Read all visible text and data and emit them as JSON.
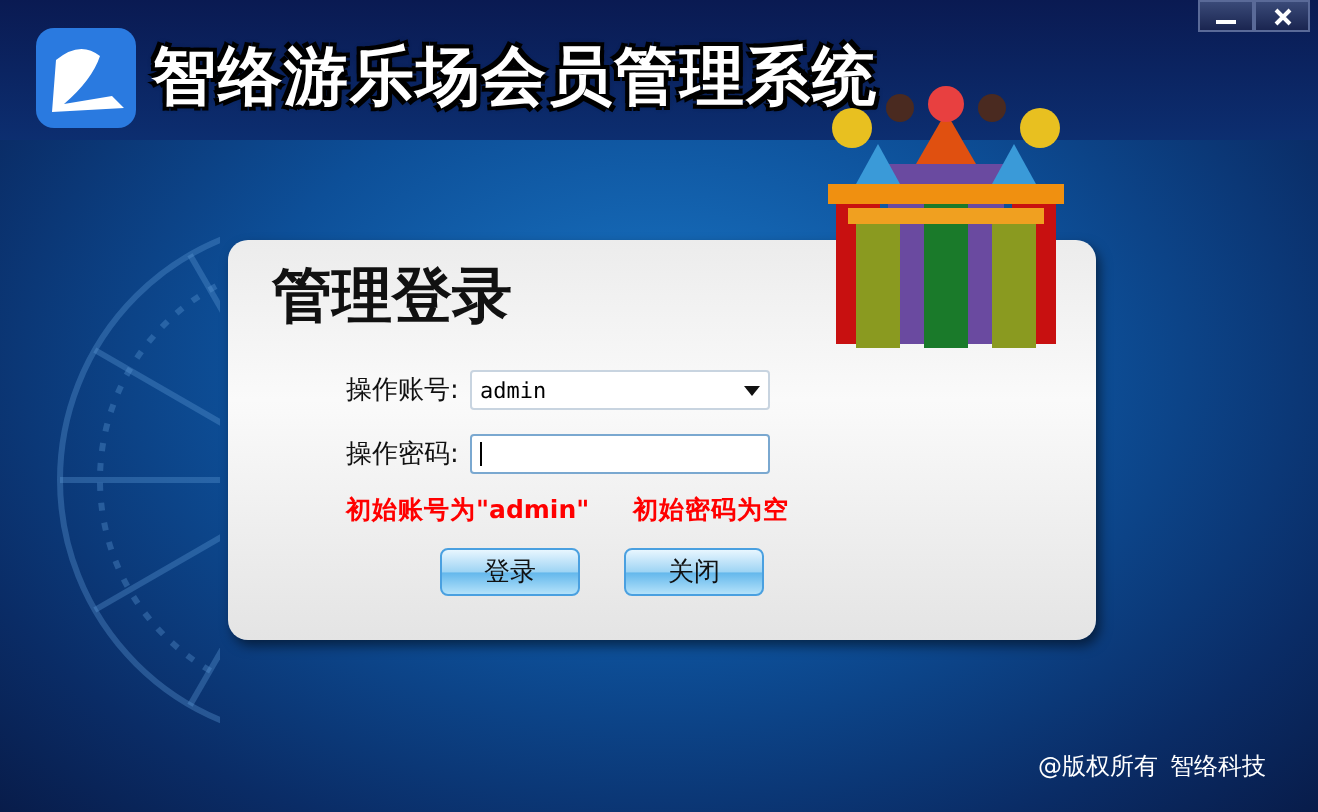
{
  "window": {
    "title": "智络游乐场会员管理系统"
  },
  "login": {
    "heading": "管理登录",
    "account": {
      "label": "操作账号:",
      "value": "admin"
    },
    "password": {
      "label": "操作密码:",
      "focused": true
    },
    "hints": [
      "初始账号为\"admin\"",
      "初始密码为空"
    ],
    "buttons": [
      "登录",
      "关闭"
    ]
  },
  "footer": [
    "@版权所有",
    "智络科技"
  ]
}
